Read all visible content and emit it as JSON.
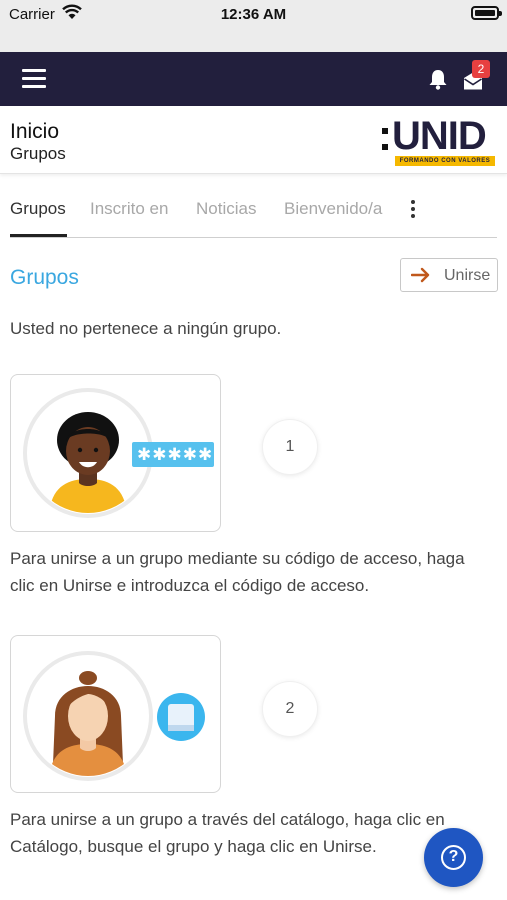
{
  "status_bar": {
    "carrier": "Carrier",
    "time": "12:36 AM"
  },
  "topbar": {
    "mail_badge": "2"
  },
  "header": {
    "title": "Inicio",
    "subtitle": "Grupos",
    "logo_text": "UNID",
    "logo_tagline": "FORMANDO CON VALORES"
  },
  "tabs": [
    {
      "label": "Grupos",
      "active": true
    },
    {
      "label": "Inscrito en"
    },
    {
      "label": "Noticias"
    },
    {
      "label": "Bienvenido/a"
    }
  ],
  "section": {
    "title": "Grupos",
    "join_label": "Unirse",
    "info": "Usted no pertenece a ningún grupo."
  },
  "steps": [
    {
      "number": "1",
      "password_mask": "✱✱✱✱✱",
      "description": "Para unirse a un grupo mediante su código de acceso, haga clic en Unirse e introduzca el código de acceso."
    },
    {
      "number": "2",
      "description": "Para unirse a un grupo a través del catálogo, haga clic en Catálogo, busque el grupo y haga clic en Unirse."
    }
  ],
  "colors": {
    "navbar": "#221f3d",
    "accent": "#3aa7e0",
    "help_button": "#1f56c2",
    "badge": "#e74040",
    "logo_band": "#f5b800",
    "join_arrow": "#c0581c"
  }
}
